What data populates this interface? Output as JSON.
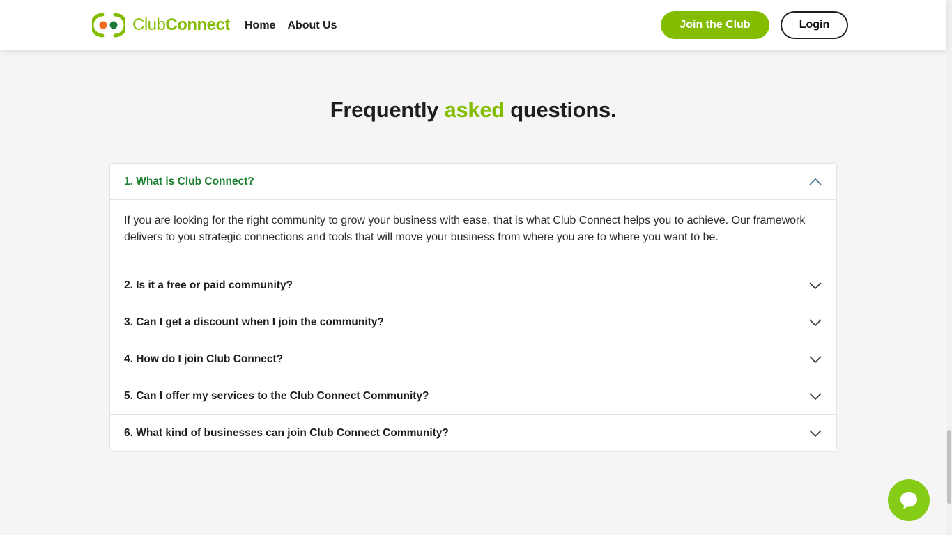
{
  "header": {
    "logo": {
      "part1": "Club",
      "part2": "Connect"
    },
    "nav": [
      {
        "label": "Home"
      },
      {
        "label": "About Us"
      }
    ],
    "join_label": "Join the Club",
    "login_label": "Login"
  },
  "faq": {
    "title": {
      "pre": "Frequently ",
      "accent": "asked",
      "post": " questions."
    },
    "items": [
      {
        "question": "1. What is Club Connect?",
        "answer": "If you are looking for the right community to grow your business with ease, that is what Club Connect helps you to achieve. Our framework delivers to you strategic connections and tools that will move your business from where you are to where you want to be.",
        "expanded": true
      },
      {
        "question": "2. Is it a free or paid community?",
        "expanded": false
      },
      {
        "question": "3. Can I get a discount when I join the community?",
        "expanded": false
      },
      {
        "question": "4. How do I join Club Connect?",
        "expanded": false
      },
      {
        "question": "5. Can I offer my services to the Club Connect Community?",
        "expanded": false
      },
      {
        "question": "6. What kind of businesses can join Club Connect Community?",
        "expanded": false
      }
    ]
  },
  "icons": {
    "logo": "club-connect-logo-icon",
    "expanded": "chevron-up-icon",
    "collapsed": "chevron-down-icon",
    "chat": "chat-bubble-icon"
  },
  "colors": {
    "brand_green": "#84bd00",
    "open_question": "#1a7f2e",
    "logo_orange": "#f26b21",
    "logo_dark_green": "#1f7a3a",
    "chevron_up": "#3d6f86",
    "chevron_down": "#333333"
  }
}
